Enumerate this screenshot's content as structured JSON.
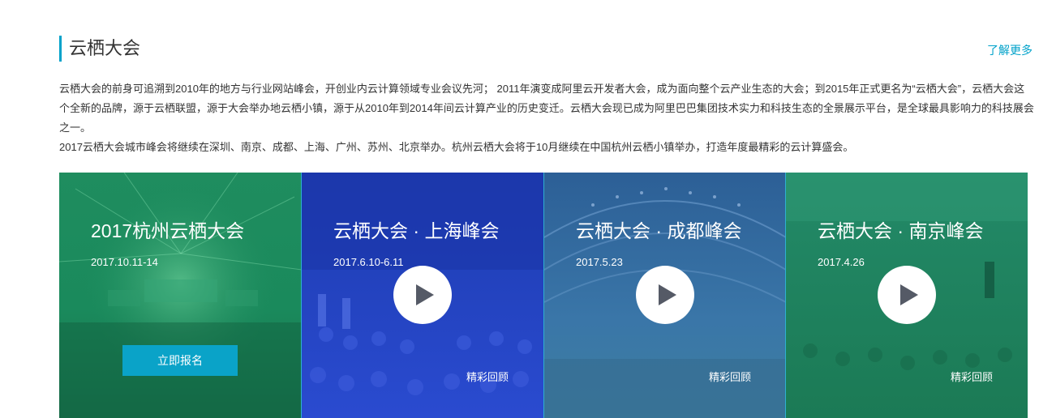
{
  "section": {
    "title": "云栖大会",
    "more_label": "了解更多",
    "accent_color": "#00a2ca"
  },
  "intro": {
    "paragraph1": "云栖大会的前身可追溯到2010年的地方与行业网站峰会，开创业内云计算领域专业会议先河； 2011年演变成阿里云开发者大会，成为面向整个云产业生态的大会；到2015年正式更名为“云栖大会”，云栖大会这个全新的品牌，源于云栖联盟，源于大会举办地云栖小镇，源于从2010年到2014年间云计算产业的历史变迁。云栖大会现已成为阿里巴巴集团技术实力和科技生态的全景展示平台，是全球最具影响力的科技展会之一。",
    "paragraph2": "2017云栖大会城市峰会将继续在深圳、南京、成都、上海、广州、苏州、北京举办。杭州云栖大会将于10月继续在中国杭州云栖小镇举办，打造年度最精彩的云计算盛会。"
  },
  "cards": [
    {
      "title": "2017杭州云栖大会",
      "date": "2017.10.11-14",
      "button_label": "立即报名",
      "overlay_color": "#1c8a5e"
    },
    {
      "title": "云栖大会 · 上海峰会",
      "date": "2017.6.10-6.11",
      "review_label": "精彩回顾",
      "play_icon": "play-icon",
      "overlay_color": "#2239b8"
    },
    {
      "title": "云栖大会 · 成都峰会",
      "date": "2017.5.23",
      "review_label": "精彩回顾",
      "play_icon": "play-icon",
      "overlay_color": "#2b6f9a"
    },
    {
      "title": "云栖大会 · 南京峰会",
      "date": "2017.4.26",
      "review_label": "精彩回顾",
      "play_icon": "play-icon",
      "overlay_color": "#1e8a64"
    }
  ]
}
